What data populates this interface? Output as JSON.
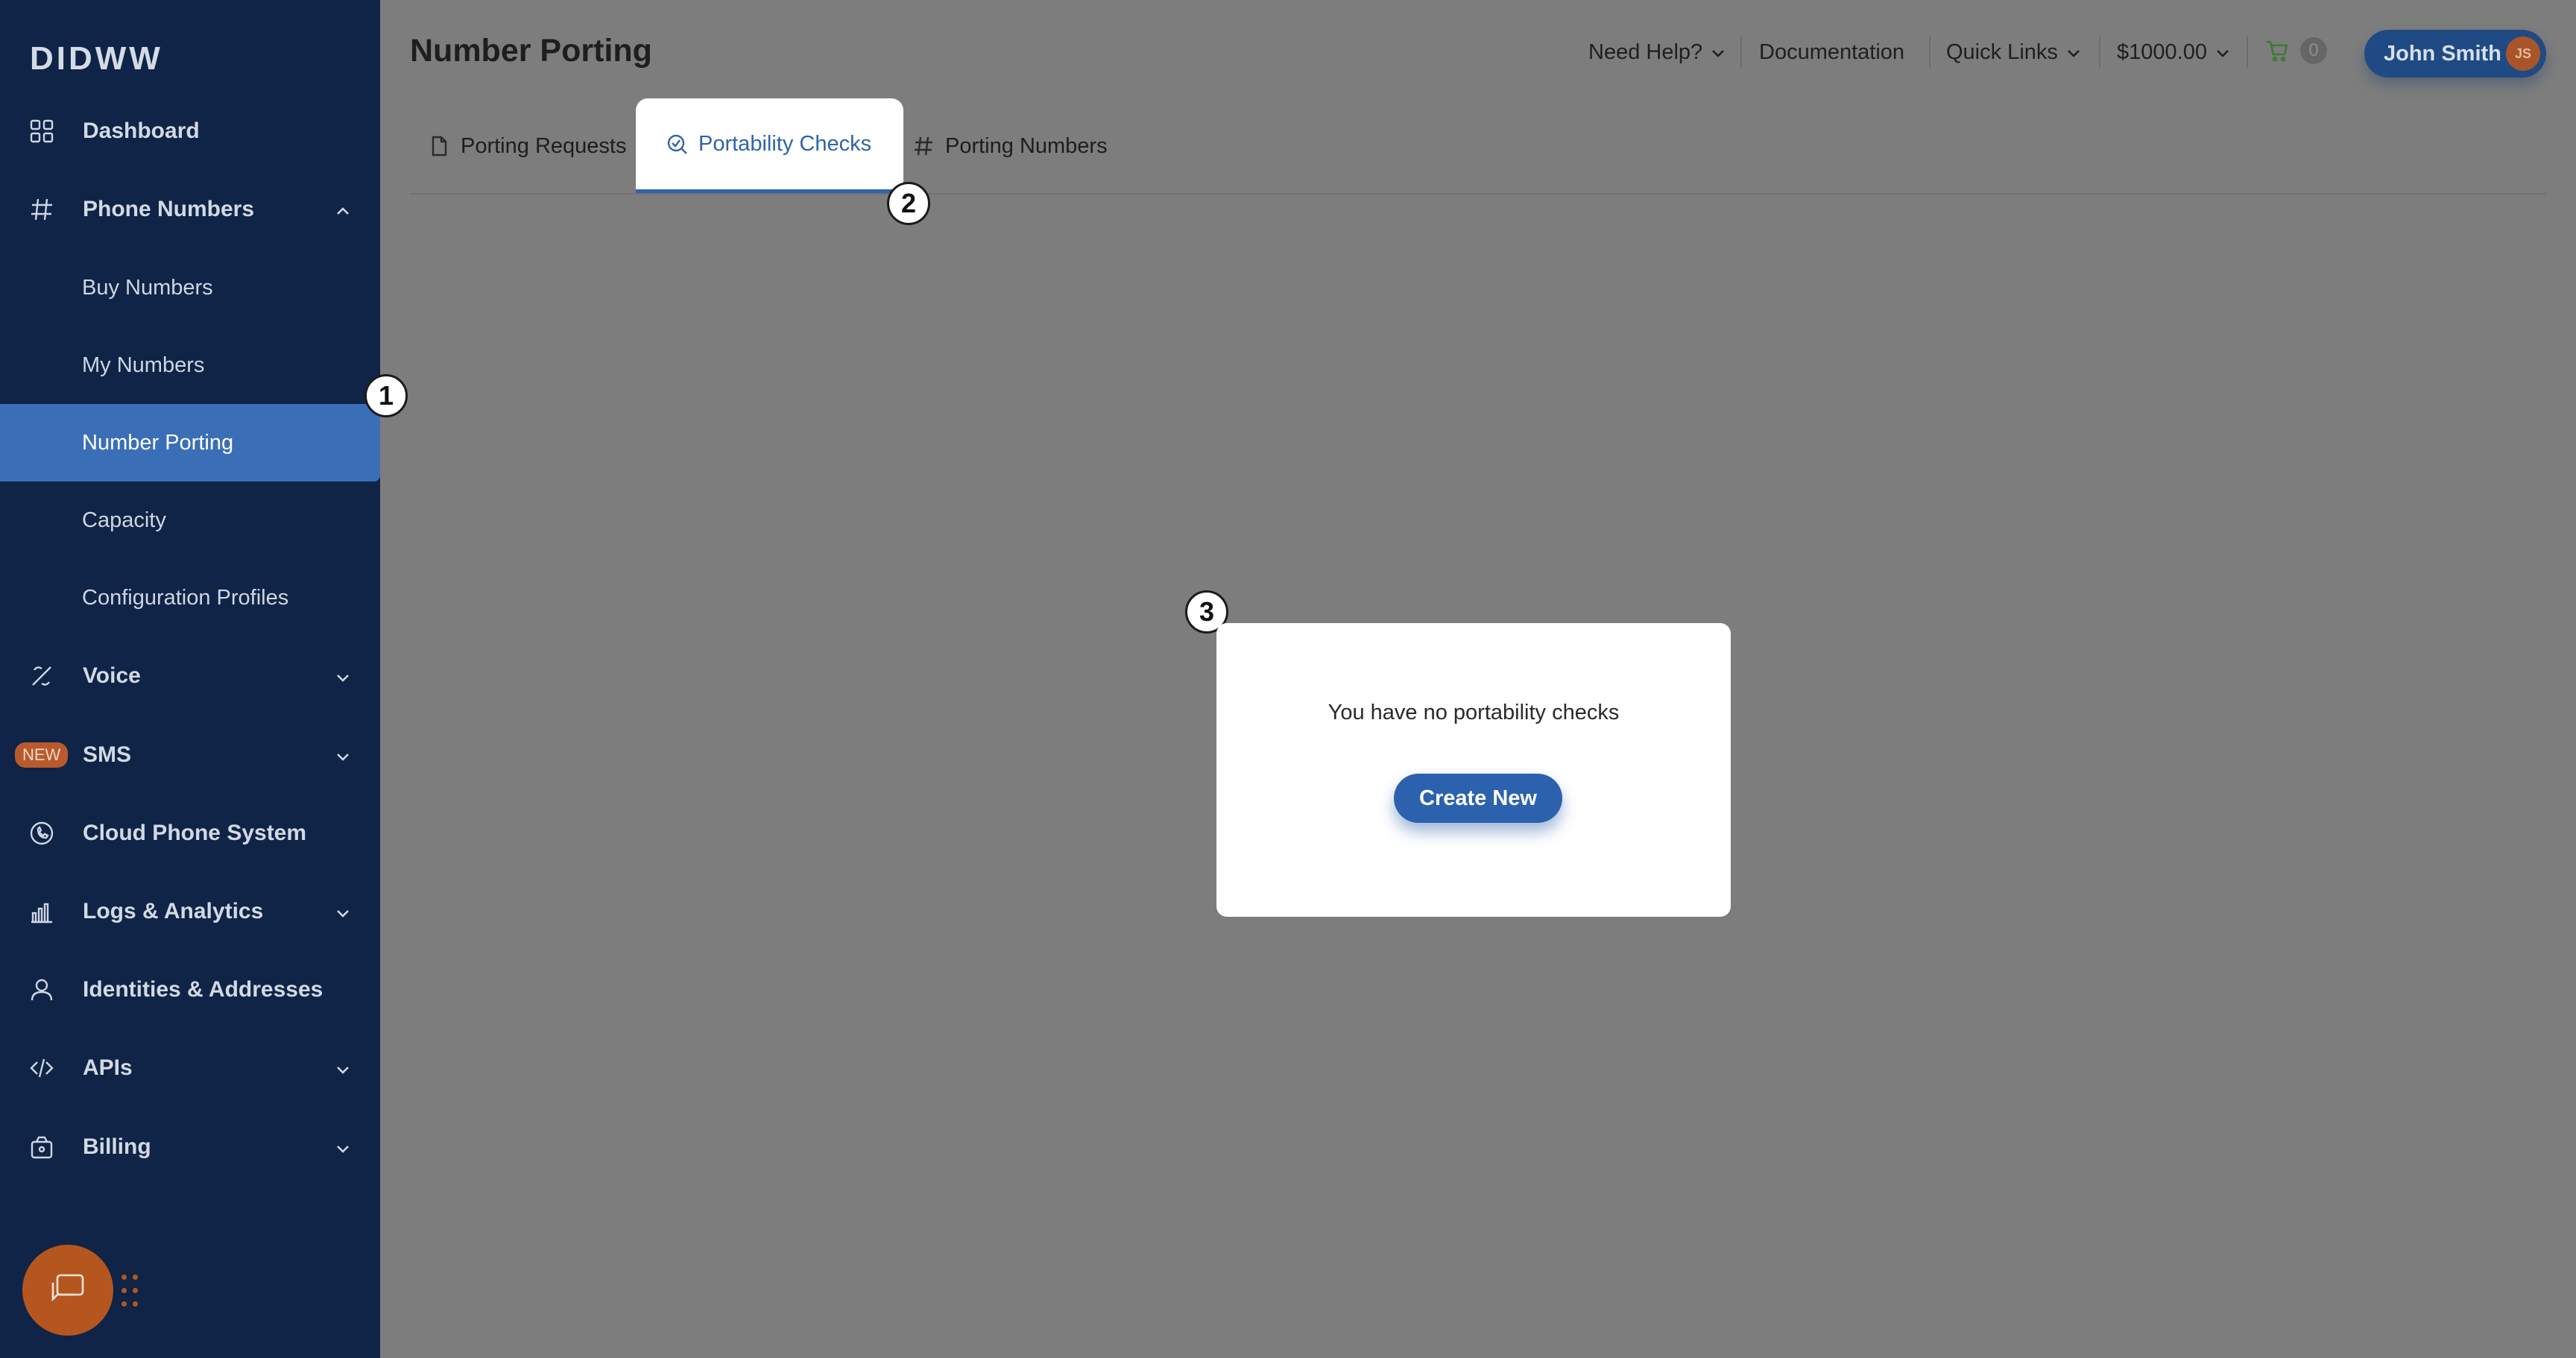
{
  "sidebar": {
    "logo": "DIDWW",
    "items": [
      {
        "label": "Dashboard",
        "icon": "grid-icon"
      },
      {
        "label": "Phone Numbers",
        "icon": "hash-icon",
        "expanded": true,
        "children": [
          "Buy Numbers",
          "My Numbers",
          "Number Porting",
          "Capacity",
          "Configuration Profiles"
        ],
        "active_child": "Number Porting"
      },
      {
        "label": "Voice",
        "icon": "voice-icon"
      },
      {
        "label": "SMS",
        "icon": "new-badge",
        "badge": "NEW"
      },
      {
        "label": "Cloud Phone System",
        "icon": "phone-icon"
      },
      {
        "label": "Logs & Analytics",
        "icon": "chart-icon"
      },
      {
        "label": "Identities & Addresses",
        "icon": "user-icon"
      },
      {
        "label": "APIs",
        "icon": "code-icon"
      },
      {
        "label": "Billing",
        "icon": "wallet-icon"
      }
    ]
  },
  "header": {
    "title": "Number Porting",
    "need_help": "Need Help?",
    "documentation": "Documentation",
    "quick_links": "Quick Links",
    "balance": "$1000.00",
    "cart_count": "0",
    "user_name": "John Smith",
    "user_initials": "JS"
  },
  "tabs": [
    {
      "label": "Porting Requests",
      "icon": "document-icon"
    },
    {
      "label": "Portability Checks",
      "icon": "search-check-icon",
      "active": true
    },
    {
      "label": "Porting Numbers",
      "icon": "hash-icon"
    }
  ],
  "steps": [
    "1",
    "2",
    "3"
  ],
  "empty_state": {
    "message": "You have no portability checks",
    "button": "Create New"
  },
  "colors": {
    "sidebar_bg": "#0f2447",
    "active_item": "#3a6fb7",
    "primary": "#2c62ad",
    "overlay": "#7d7d7d",
    "accent_orange": "#b5561f"
  }
}
